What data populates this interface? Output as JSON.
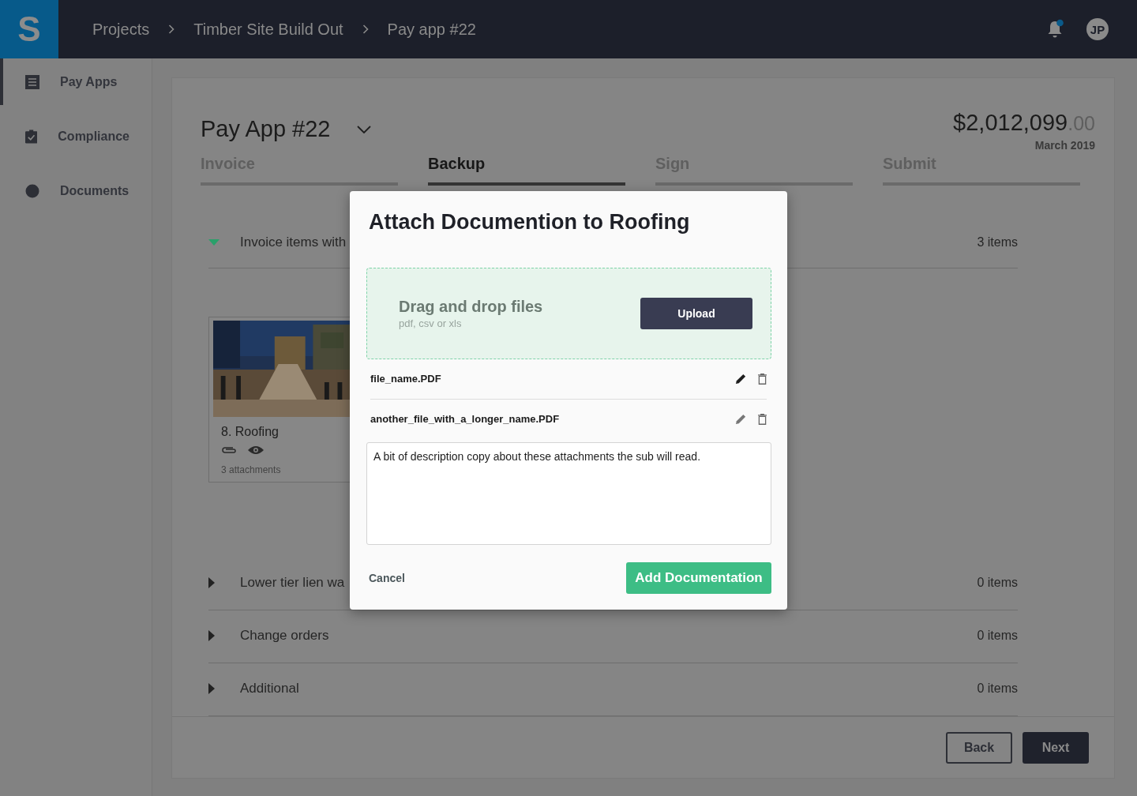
{
  "top_bar": {
    "logo": "S",
    "breadcrumbs": [
      "Projects",
      "Timber Site Build Out",
      "Pay app #22"
    ],
    "notifications": {
      "unread": true
    },
    "avatar": "JP"
  },
  "sidebar": {
    "items": [
      {
        "label": "Pay Apps",
        "selected": true
      },
      {
        "label": "Compliance",
        "selected": false
      },
      {
        "label": "Documents",
        "selected": false
      }
    ]
  },
  "pay_app": {
    "title": "Pay App #22",
    "amount": "$2,012,099",
    "amount_cents": ".00",
    "period": "March 2019"
  },
  "steps": [
    {
      "label": "Invoice",
      "selected": false
    },
    {
      "label": "Backup",
      "selected": true
    },
    {
      "label": "Sign",
      "selected": false
    },
    {
      "label": "Submit",
      "selected": false
    }
  ],
  "sections": [
    {
      "title": "Invoice items with",
      "count": "3 items",
      "expanded": true,
      "cards": [
        {
          "kind": "picture",
          "title": "8. Roofing",
          "caption": "3 attachments"
        }
      ]
    },
    {
      "title": "Lower tier lien wa",
      "count": "0 items",
      "expanded": false
    },
    {
      "title": "Change orders",
      "count": "0 items",
      "expanded": false
    },
    {
      "title": "Additional",
      "count": "0 items",
      "expanded": false
    }
  ],
  "footer": {
    "buttons": [
      {
        "label": "Back",
        "kind": "secondary"
      },
      {
        "label": "Next",
        "kind": "primary"
      }
    ]
  },
  "modal": {
    "title": "Attach Documention to Roofing",
    "dropzone": {
      "title": "Drag and drop files",
      "hint": "pdf, csv or xls",
      "button": "Upload"
    },
    "files": [
      {
        "name": "file_name.PDF"
      },
      {
        "name": "another_file_with_a_longer_name.PDF"
      }
    ],
    "description": {
      "value": "A bit of description copy about these attachments the sub will read."
    },
    "cancel": "Cancel",
    "submit": "Add Documentation"
  }
}
